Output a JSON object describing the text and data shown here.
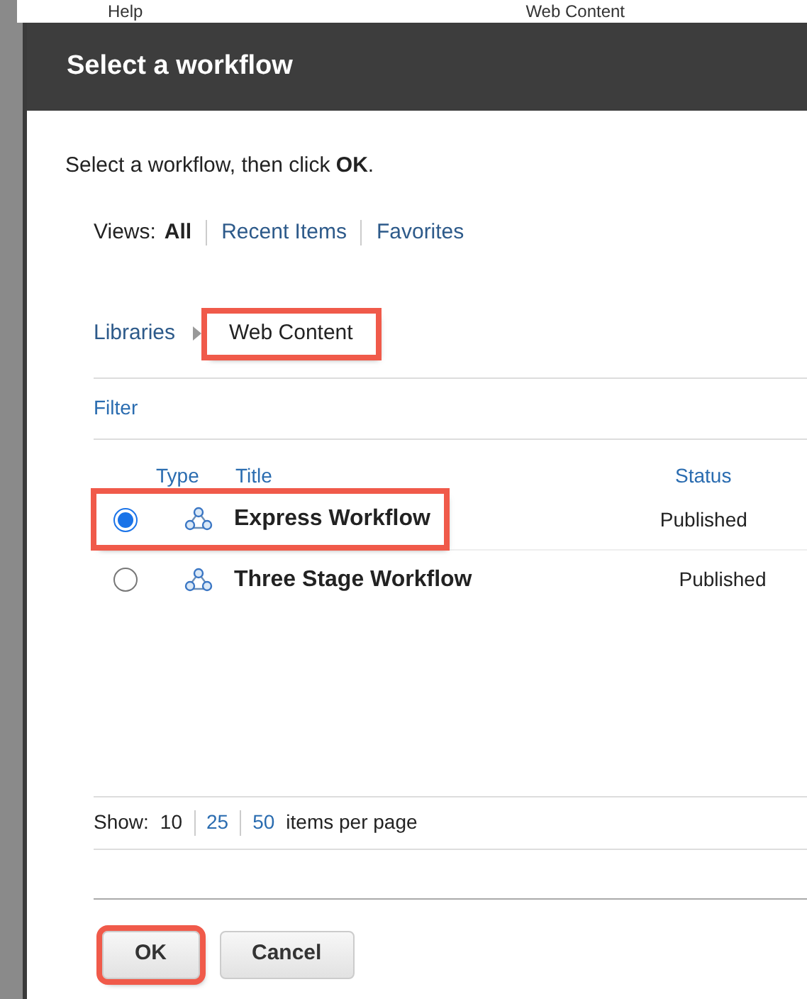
{
  "background": {
    "help_link": "Help",
    "location": "Web Content"
  },
  "dialog": {
    "title": "Select a workflow",
    "instruction": "Select a workflow, then click **OK**.",
    "views": {
      "label": "Views:",
      "items": [
        {
          "label": "All",
          "selected": true
        },
        {
          "label": "Recent Items",
          "selected": false
        },
        {
          "label": "Favorites",
          "selected": false
        }
      ]
    },
    "breadcrumb": {
      "parent": "Libraries",
      "current": "Web Content",
      "highlighted": true
    },
    "filter": "Filter",
    "table": {
      "columns": [
        "Type",
        "Title",
        "Status"
      ],
      "rows": [
        {
          "title": "Express Workflow",
          "status": "Published",
          "selected": true,
          "highlighted": true
        },
        {
          "title": "Three Stage Workflow",
          "status": "Published",
          "selected": false,
          "highlighted": false
        }
      ]
    },
    "pagination": {
      "label": "Show:",
      "sizes": [
        {
          "label": "10",
          "selected": true
        },
        {
          "label": "25",
          "selected": false
        },
        {
          "label": "50",
          "selected": false
        }
      ],
      "suffix": "items per page"
    },
    "buttons": [
      {
        "label": "OK",
        "highlighted": true
      },
      {
        "label": "Cancel",
        "highlighted": false
      }
    ]
  }
}
